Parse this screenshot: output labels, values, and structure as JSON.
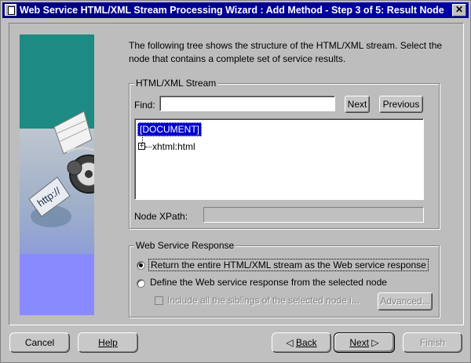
{
  "window": {
    "title": "Web Service HTML/XML Stream Processing Wizard : Add Method - Step 3 of 5: Result Node"
  },
  "intro": {
    "text": "The following tree shows the structure of the HTML/XML stream. Select the node that contains a complete set of service results."
  },
  "stream": {
    "legend": "HTML/XML Stream",
    "find_label": "Find:",
    "find_value": "",
    "next_label": "Next",
    "previous_label": "Previous",
    "tree": {
      "root": "[DOCUMENT]",
      "child": "xhtml:html"
    },
    "xpath_label": "Node XPath:",
    "xpath_value": ""
  },
  "response": {
    "legend": "Web Service Response",
    "option_entire": "Return the entire HTML/XML stream as the Web service response",
    "option_selected": "Define the Web service response from the selected node",
    "selected_option": "entire",
    "include_siblings": "Include all the siblings of the selected node i...",
    "advanced_label": "Advanced..."
  },
  "buttons": {
    "cancel": "Cancel",
    "help": "Help",
    "back": "Back",
    "next": "Next",
    "finish": "Finish"
  },
  "banner": {
    "url_text": "http://"
  },
  "colors": {
    "title_bar": "#000080",
    "banner_teal": "#1d8a83",
    "banner_violet": "#8a8aff",
    "selection": "#0000cc"
  }
}
